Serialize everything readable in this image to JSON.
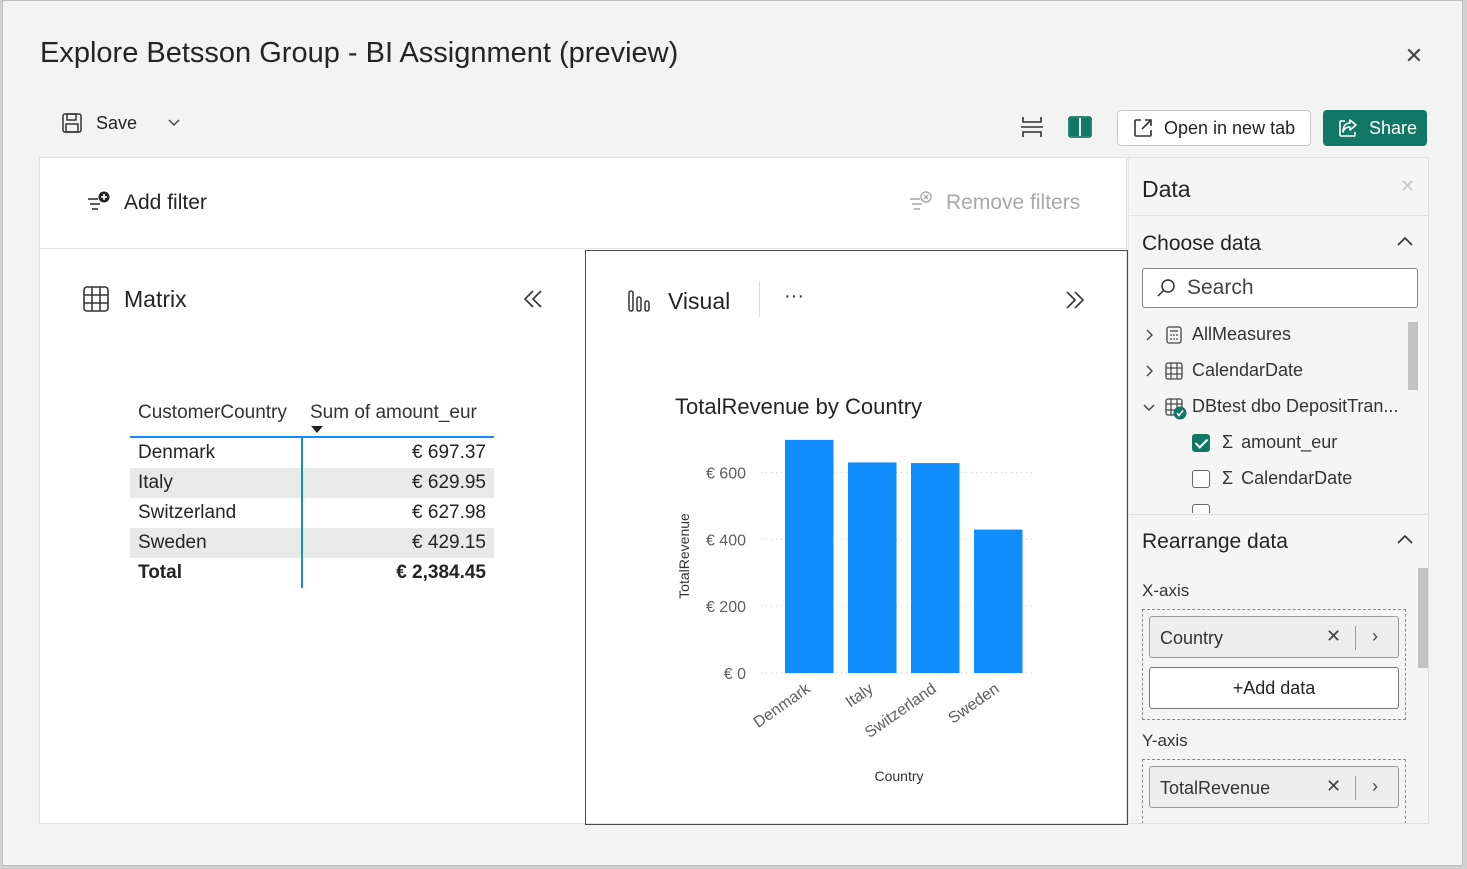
{
  "dialog": {
    "title": "Explore Betsson Group - BI Assignment (preview)",
    "close_icon": "close-icon"
  },
  "toolbar": {
    "save_label": "Save",
    "open_new_tab_label": "Open in new tab",
    "share_label": "Share",
    "share_color": "#117865"
  },
  "filterbar": {
    "add_filter_label": "Add filter",
    "remove_filters_label": "Remove filters"
  },
  "matrix": {
    "title": "Matrix",
    "headers": [
      "CustomerCountry",
      "Sum of amount_eur"
    ],
    "rows": [
      {
        "country": "Denmark",
        "value": "€ 697.37"
      },
      {
        "country": "Italy",
        "value": "€ 629.95"
      },
      {
        "country": "Switzerland",
        "value": "€ 627.98"
      },
      {
        "country": "Sweden",
        "value": "€ 429.15"
      }
    ],
    "total_label": "Total",
    "total_value": "€ 2,384.45"
  },
  "visual": {
    "title": "Visual",
    "more_label": "···"
  },
  "chart_data": {
    "type": "bar",
    "title": "TotalRevenue by Country",
    "xlabel": "Country",
    "ylabel": "TotalRevenue",
    "categories": [
      "Denmark",
      "Italy",
      "Switzerland",
      "Sweden"
    ],
    "values": [
      697.37,
      629.95,
      627.98,
      429.15
    ],
    "ylim": [
      0,
      700
    ],
    "yticks": [
      0,
      200,
      400,
      600
    ],
    "ytick_labels": [
      "€ 0",
      "€ 200",
      "€ 400",
      "€ 600"
    ],
    "bar_color": "#118dff",
    "grid": true
  },
  "data_pane": {
    "title": "Data",
    "choose_data_title": "Choose data",
    "search_placeholder": "Search",
    "tree": [
      {
        "label": "AllMeasures",
        "icon": "calculator-icon"
      },
      {
        "label": "CalendarDate",
        "icon": "table-icon"
      },
      {
        "label": "DBtest dbo DepositTran...",
        "icon": "table-icon"
      }
    ],
    "fields": [
      {
        "label": "amount_eur",
        "checked": true
      },
      {
        "label": "CalendarDate",
        "checked": false
      }
    ],
    "rearrange_title": "Rearrange data",
    "x_axis_label": "X-axis",
    "x_axis_field": "Country",
    "add_data_label": "+Add data",
    "y_axis_label": "Y-axis",
    "y_axis_field": "TotalRevenue"
  }
}
